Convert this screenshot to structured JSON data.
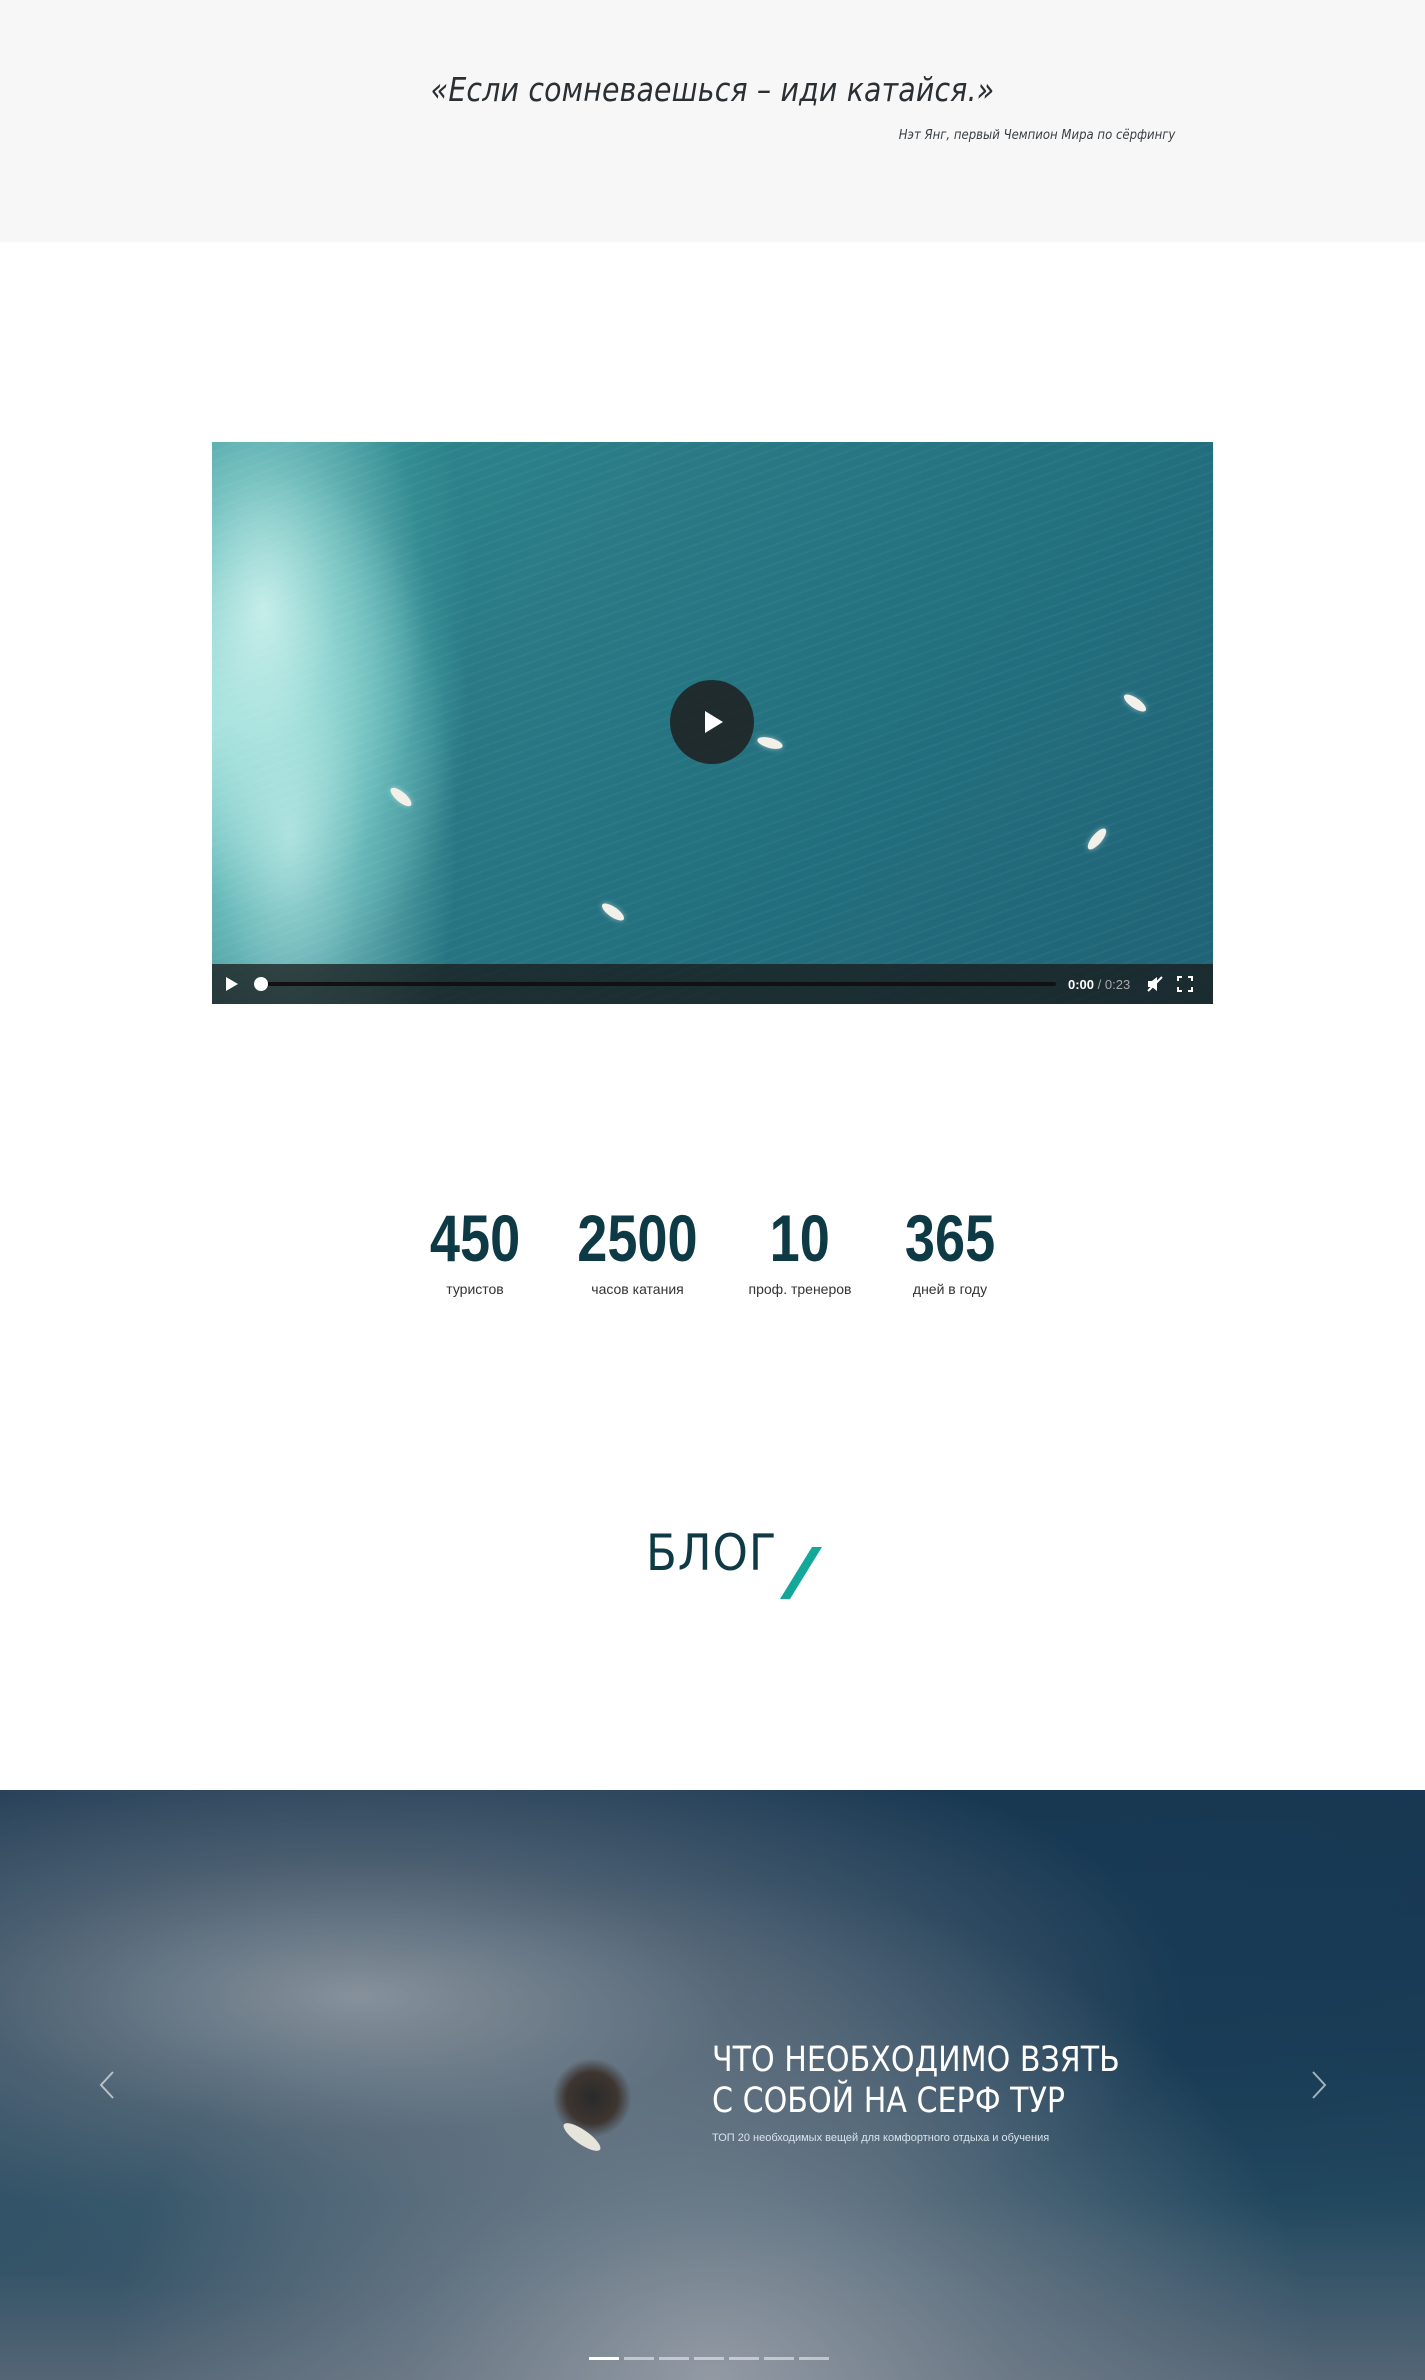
{
  "quote": {
    "text": "«Если сомневаешься – иди катайся.»",
    "author": "Нэт Янг, первый Чемпион Мира по сёрфингу"
  },
  "video": {
    "current_time": "0:00",
    "total_time": "/ 0:23",
    "progress": 0
  },
  "stats": [
    {
      "value": "450",
      "label": "туристов"
    },
    {
      "value": "2500",
      "label": "часов катания"
    },
    {
      "value": "10",
      "label": "проф. тренеров"
    },
    {
      "value": "365",
      "label": "дней в году"
    }
  ],
  "blog": {
    "title": "БЛОГ",
    "accent_color": "#14a89a"
  },
  "slider": {
    "title": "ЧТО НЕОБХОДИМО ВЗЯТЬ С СОБОЙ НА СЕРФ ТУР",
    "subtitle": "ТОП 20 необходимых вещей для комфортного отдыха и обучения",
    "slide_count": 7,
    "active_slide": 1
  },
  "colors": {
    "brand_dark": "#0d3a44",
    "quote_bg": "#f7f7f7"
  }
}
